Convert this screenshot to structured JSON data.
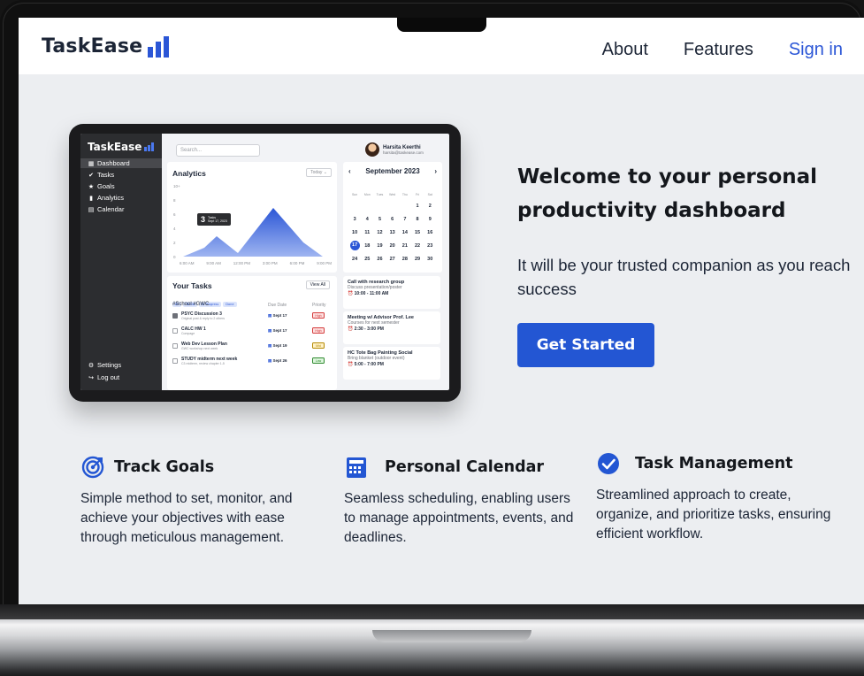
{
  "nav": {
    "brand": "TaskEase",
    "links": [
      "About",
      "Features",
      "Sign in"
    ]
  },
  "dashboard": {
    "brand": "TaskEase",
    "sidebar": [
      "Dashboard",
      "Tasks",
      "Goals",
      "Analytics",
      "Calendar"
    ],
    "settings": "Settings",
    "logout": "Log out",
    "search_placeholder": "Search...",
    "user_name": "Harsita Keerthi",
    "user_email": "harsita@taskease.com",
    "analytics": {
      "title": "Analytics",
      "period": "Today",
      "y_ticks": [
        "10+",
        "8",
        "6",
        "4",
        "2",
        "0"
      ],
      "x_ticks": [
        "6:00 AM",
        "9:00 AM",
        "12:00 PM",
        "3:00 PM",
        "6:00 PM",
        "9:00 PM"
      ],
      "tooltip_value": "3",
      "tooltip_label": "Tasks",
      "tooltip_date": "Sept 17, 2023"
    },
    "calendar": {
      "month": "September 2023",
      "dow": [
        "Sun",
        "Mon",
        "Tues",
        "Wed",
        "Thu",
        "Fri",
        "Sat"
      ],
      "weeks": [
        [
          "",
          "",
          "",
          "",
          "",
          "1",
          "2"
        ],
        [
          "3",
          "4",
          "5",
          "6",
          "7",
          "8",
          "9"
        ],
        [
          "10",
          "11",
          "12",
          "13",
          "14",
          "15",
          "16"
        ],
        [
          "17",
          "18",
          "19",
          "20",
          "21",
          "22",
          "23"
        ],
        [
          "24",
          "25",
          "26",
          "27",
          "28",
          "29",
          "30"
        ]
      ],
      "today": "17"
    },
    "events": [
      {
        "title": "Call with research group",
        "desc": "Discuss presentation/poster",
        "time": "10:00 - 11:00 AM"
      },
      {
        "title": "Meeting w/ Advisor Prof. Lee",
        "desc": "Courses for next semester",
        "time": "2:30 - 3:00 PM"
      },
      {
        "title": "HC Tote Bag Painting Social",
        "desc": "Bring blanket (outdoor event)",
        "time": "5:00 - 7:00 PM"
      }
    ],
    "tasks": {
      "title": "Your Tasks",
      "view_all": "View All",
      "filters": [
        "All",
        "To Do",
        "In Progress",
        "Done"
      ],
      "tags": "#School  #GWC",
      "col_due": "Due Date",
      "col_priority": "Priority",
      "rows": [
        {
          "name": "PSYC Discussion 3",
          "sub": "Original post & reply to 2 others",
          "due": "Sept 17",
          "priority": "High",
          "done": true
        },
        {
          "name": "CALC HW 1",
          "sub": "Compage",
          "due": "Sept 17",
          "priority": "High",
          "done": false
        },
        {
          "name": "Web Dev Lesson Plan",
          "sub": "GWC workshop next week",
          "due": "Sept 19",
          "priority": "Mid",
          "done": false
        },
        {
          "name": "STUDY midterm next week",
          "sub": "C3 midterm, review chapter 1-5",
          "due": "Sept 26",
          "priority": "Low",
          "done": false
        }
      ]
    }
  },
  "hero": {
    "title": "Welcome to your personal productivity dashboard",
    "subtitle": "It will be your trusted companion as you reach success",
    "cta": "Get Started"
  },
  "features": [
    {
      "title": "Track Goals",
      "icon": "target-icon",
      "desc": "Simple method to set, monitor, and achieve your objectives with ease through meticulous management."
    },
    {
      "title": "Personal Calendar",
      "icon": "calendar-icon",
      "desc": "Seamless scheduling, enabling users to manage appointments, events, and deadlines."
    },
    {
      "title": "Task Management",
      "icon": "check-circle-icon",
      "desc": "Streamlined approach to create, organize, and prioritize tasks, ensuring efficient workflow."
    }
  ],
  "colors": {
    "accent": "#2356d3",
    "page_bg": "#eceef1",
    "text": "#14171c"
  }
}
